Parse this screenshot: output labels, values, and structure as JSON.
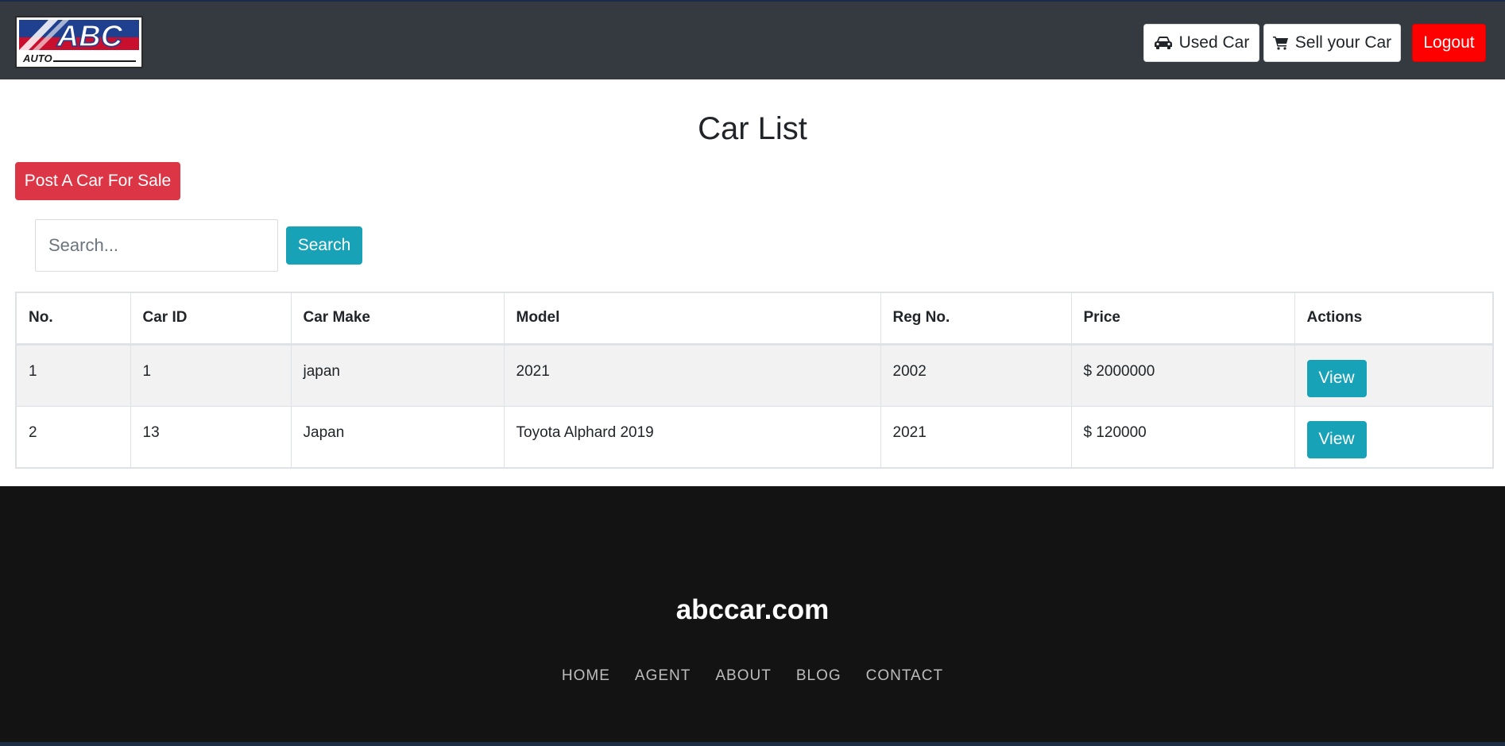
{
  "header": {
    "logo": {
      "text_main": "ABC",
      "text_sub": "AUTO"
    },
    "nav": {
      "used_car_label": "Used Car",
      "sell_car_label": "Sell your Car",
      "logout_label": "Logout"
    }
  },
  "main": {
    "title": "Car List",
    "post_button_label": "Post A Car For Sale",
    "search": {
      "placeholder": "Search...",
      "value": "",
      "button_label": "Search"
    },
    "table": {
      "headers": [
        "No.",
        "Car ID",
        "Car Make",
        "Model",
        "Reg No.",
        "Price",
        "Actions"
      ],
      "rows": [
        {
          "no": "1",
          "car_id": "1",
          "make": "japan",
          "model": "2021",
          "reg_no": "2002",
          "price": "$ 2000000",
          "action": "View"
        },
        {
          "no": "2",
          "car_id": "13",
          "make": "Japan",
          "model": "Toyota Alphard 2019",
          "reg_no": "2021",
          "price": "$ 120000",
          "action": "View"
        }
      ]
    }
  },
  "footer": {
    "brand": "abccar.com",
    "links": [
      "HOME",
      "AGENT",
      "ABOUT",
      "BLOG",
      "CONTACT"
    ]
  },
  "icons": {
    "used_car": "car-icon",
    "sell_car": "shopping-cart-icon"
  },
  "colors": {
    "navbar": "#343a40",
    "logout": "#ff0000",
    "post_button": "#dc3545",
    "info_button": "#17a2b8",
    "footer": "#131313"
  }
}
